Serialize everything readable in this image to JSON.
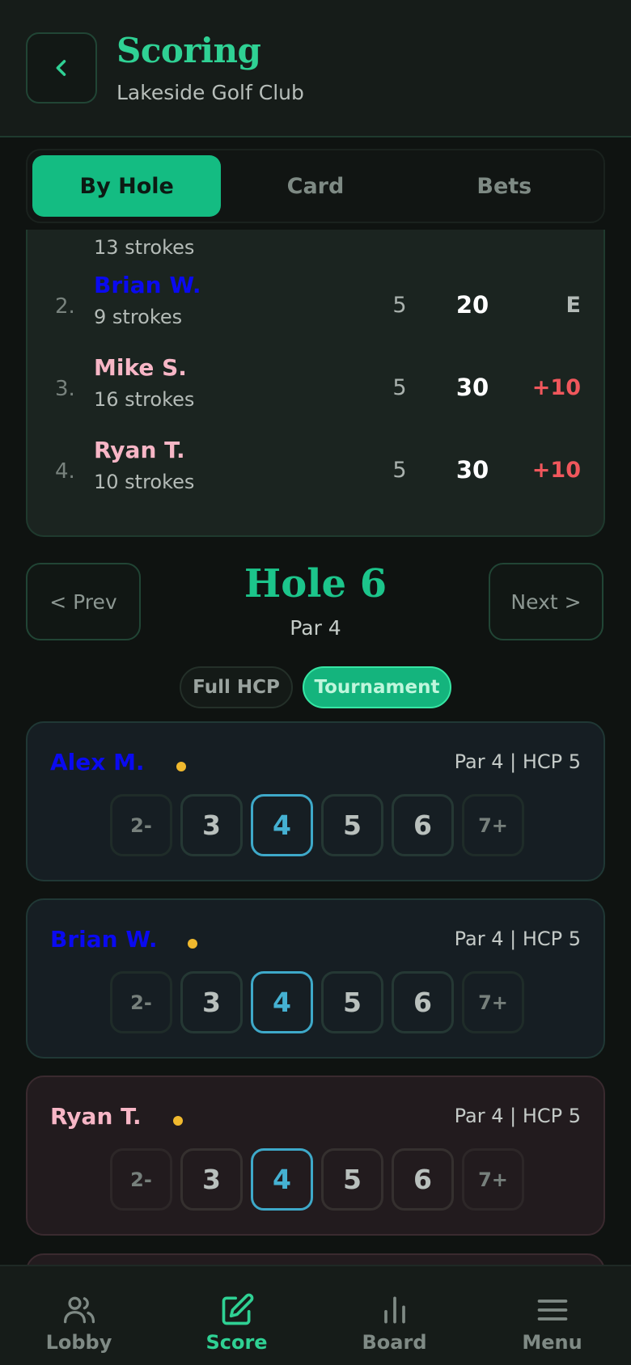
{
  "header": {
    "title": "Scoring",
    "subtitle": "Lakeside Golf Club"
  },
  "tabs": [
    {
      "label": "By Hole",
      "active": true
    },
    {
      "label": "Card",
      "active": false
    },
    {
      "label": "Bets",
      "active": false
    }
  ],
  "leaderboard": {
    "partial_row": {
      "strokes": "13 strokes"
    },
    "rows": [
      {
        "rank": "2.",
        "name": "Brian W.",
        "strokes": "9 strokes",
        "holes": "5",
        "total": "20",
        "diff": "E"
      },
      {
        "rank": "3.",
        "name": "Mike S.",
        "strokes": "16 strokes",
        "holes": "5",
        "total": "30",
        "diff": "+10"
      },
      {
        "rank": "4.",
        "name": "Ryan T.",
        "strokes": "10 strokes",
        "holes": "5",
        "total": "30",
        "diff": "+10"
      }
    ]
  },
  "hole_nav": {
    "prev_label": "< Prev",
    "next_label": "Next >",
    "hole_title": "Hole 6",
    "par_label": "Par 4"
  },
  "handicap_toggle": {
    "options": [
      "Full HCP",
      "Tournament"
    ],
    "selected": "Tournament"
  },
  "players": [
    {
      "name": "Alex M.",
      "info": "Par 4 | HCP 5",
      "selected_score": "4"
    },
    {
      "name": "Brian W.",
      "info": "Par 4 | HCP 5",
      "selected_score": "4"
    },
    {
      "name": "Ryan T.",
      "info": "Par 4 | HCP 5",
      "selected_score": "4"
    }
  ],
  "score_options": [
    "2-",
    "3",
    "4",
    "5",
    "6",
    "7+"
  ],
  "bottom_nav": [
    {
      "label": "Lobby",
      "icon": "users-icon",
      "active": false
    },
    {
      "label": "Score",
      "icon": "edit-icon",
      "active": true
    },
    {
      "label": "Board",
      "icon": "bar-chart-icon",
      "active": false
    },
    {
      "label": "Menu",
      "icon": "menu-icon",
      "active": false
    }
  ],
  "colors": {
    "accent": "#14bc82",
    "blue_name": "#0a0af0",
    "pink_name": "#f7b6c6",
    "negative": "#f0575c",
    "selected_score": "#3ea9c9"
  }
}
